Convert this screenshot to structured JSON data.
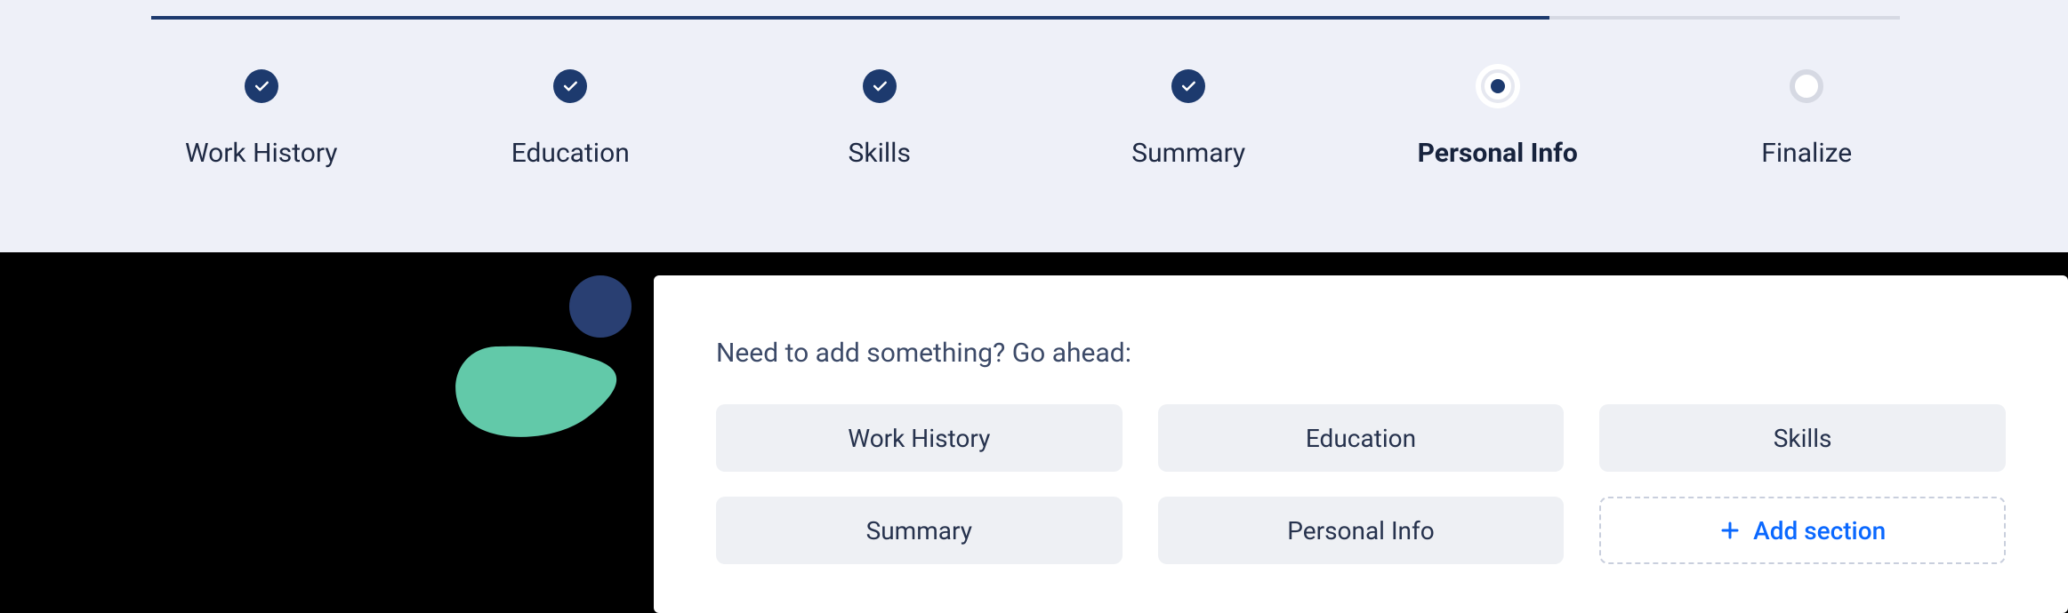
{
  "stepper": {
    "steps": [
      {
        "label": "Work History",
        "state": "done"
      },
      {
        "label": "Education",
        "state": "done"
      },
      {
        "label": "Skills",
        "state": "done"
      },
      {
        "label": "Summary",
        "state": "done"
      },
      {
        "label": "Personal Info",
        "state": "current"
      },
      {
        "label": "Finalize",
        "state": "future"
      }
    ]
  },
  "card": {
    "prompt": "Need to add something? Go ahead:",
    "sections": [
      "Work History",
      "Education",
      "Skills",
      "Summary",
      "Personal Info"
    ],
    "add_label": "Add section"
  },
  "colors": {
    "navy": "#1d3a6e",
    "teal": "#62c9a9",
    "link": "#0a68ff"
  }
}
